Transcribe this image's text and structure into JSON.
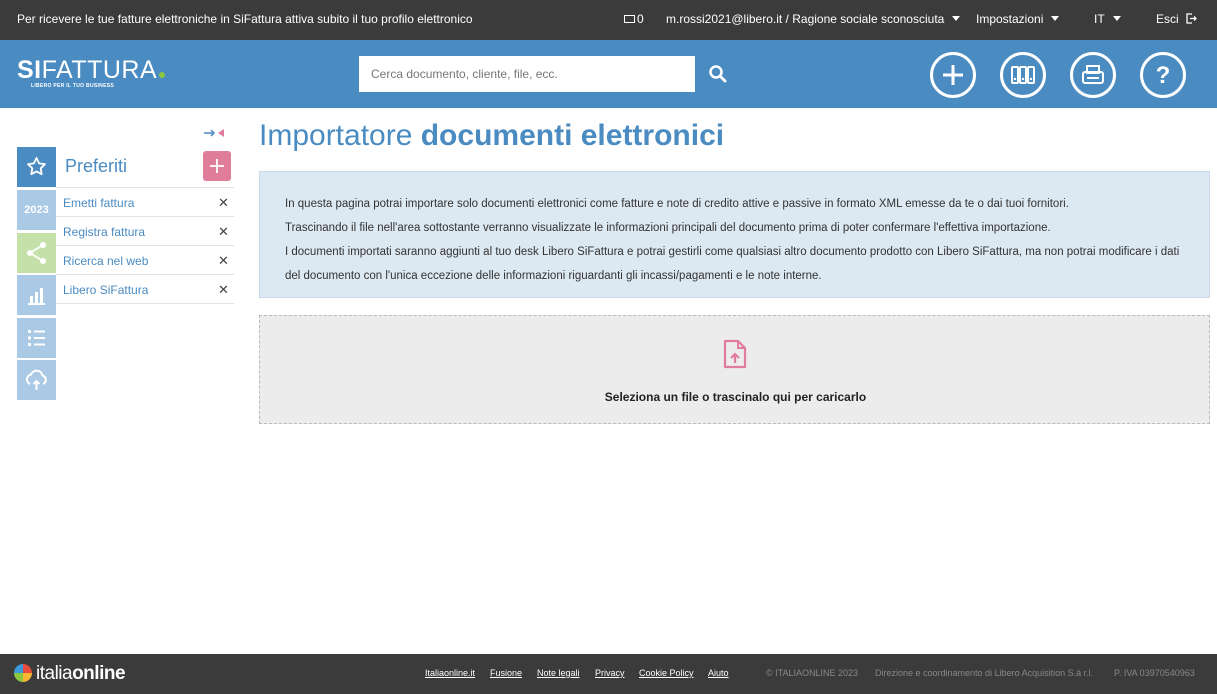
{
  "topbar": {
    "promo": "Per ricevere le tue fatture elettroniche in SiFattura attiva subito il tuo profilo elettronico",
    "mail_count": "0",
    "user": "m.rossi2021@libero.it / Ragione sociale sconosciuta",
    "settings": "Impostazioni",
    "lang": "IT",
    "logout": "Esci"
  },
  "header": {
    "logo_bold": "SI",
    "logo_text": "FATTURA",
    "logo_tagline": "LIBERO PER IL TUO BUSINESS",
    "search_placeholder": "Cerca documento, cliente, file, ecc."
  },
  "sidebar": {
    "fav_title": "Preferiti",
    "year_badge": "2023",
    "favorites": [
      {
        "label": "Emetti fattura"
      },
      {
        "label": "Registra fattura"
      },
      {
        "label": "Ricerca nel web"
      },
      {
        "label": "Libero SiFattura"
      }
    ]
  },
  "main": {
    "title_light": "Importatore ",
    "title_bold": "documenti elettronici",
    "info_lines": [
      "In questa pagina potrai importare solo documenti elettronici come fatture e note di credito attive e passive in formato XML emesse da te o dai tuoi fornitori.",
      "Trascinando il file nell'area sottostante verranno visualizzate le informazioni principali del documento prima di poter confermare l'effettiva importazione.",
      "I documenti importati saranno aggiunti al tuo desk Libero SiFattura e potrai gestirli come qualsiasi altro documento prodotto con Libero SiFattura, ma non potrai modificare i dati del documento con l'unica eccezione delle informazioni riguardanti gli incassi/pagamenti e le note interne."
    ],
    "dropzone_text": "Seleziona un file o trascinalo qui per caricarlo"
  },
  "footer": {
    "logo_light": "italia",
    "logo_bold": "online",
    "links": [
      "Italiaonline.it",
      "Fusione",
      "Note legali",
      "Privacy",
      "Cookie Policy",
      "Aiuto"
    ],
    "copyright": "© ITALIAONLINE 2023",
    "direction": "Direzione e coordinamento di Libero Acquisition S.à r.l.",
    "vat": "P. IVA 03970540963"
  },
  "colors": {
    "primary": "#4a8bc2",
    "dark_bar": "#3b3b3b",
    "accent_pink": "#e07d9b",
    "green": "#8dc63f"
  }
}
